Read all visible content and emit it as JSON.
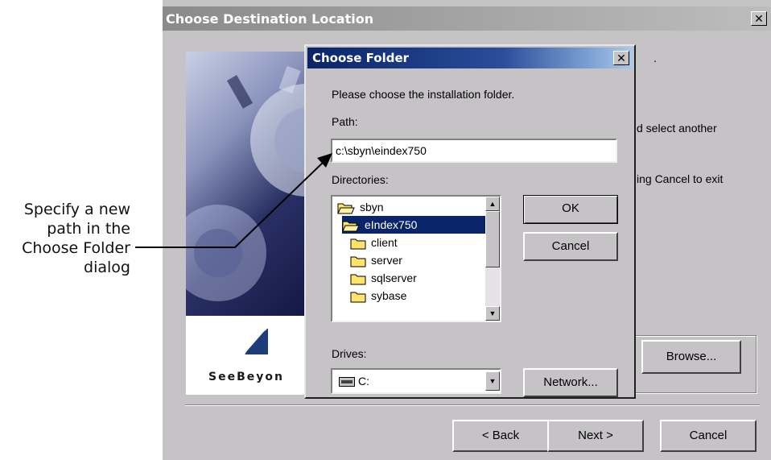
{
  "callout": {
    "line1": "Specify a new",
    "line2": "path in the",
    "line3": "Choose Folder",
    "line4": "dialog"
  },
  "outer_window": {
    "title": "Choose Destination Location",
    "close_glyph": "✕",
    "logo_text": "SeeBeyon",
    "partial_text_1": ".",
    "partial_text_2": "d select another",
    "partial_text_3": "ing Cancel to exit",
    "browse_label": "Browse...",
    "back_label": "< Back",
    "next_label": "Next >",
    "cancel_label": "Cancel"
  },
  "dialog": {
    "title": "Choose Folder",
    "close_glyph": "✕",
    "instruction": "Please choose the installation folder.",
    "path_label": "Path:",
    "path_value": "c:\\sbyn\\eindex750",
    "directories_label": "Directories:",
    "directories": [
      {
        "name": "sbyn",
        "state": "open"
      },
      {
        "name": "eIndex750",
        "state": "open",
        "selected": true
      },
      {
        "name": "client",
        "state": "closed"
      },
      {
        "name": "server",
        "state": "closed"
      },
      {
        "name": "sqlserver",
        "state": "closed"
      },
      {
        "name": "sybase",
        "state": "closed"
      }
    ],
    "ok_label": "OK",
    "cancel_label": "Cancel",
    "drives_label": "Drives:",
    "drive_value": "C:",
    "network_label": "Network..."
  },
  "icons": {
    "folder": "folder-icon",
    "open_folder": "open-folder-icon",
    "drive": "drive-icon"
  },
  "colors": {
    "dialog_bg": "#c6c3c6",
    "active_title": "#0a246a",
    "selection": "#0a246a",
    "folder_yellow": "#ffe36a"
  }
}
